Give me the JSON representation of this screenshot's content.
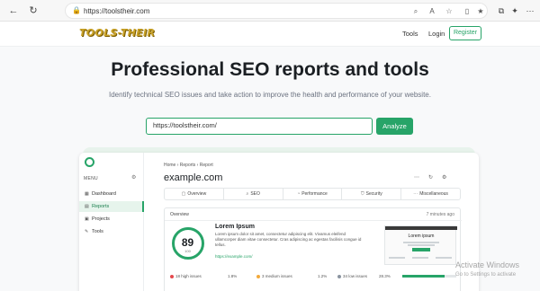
{
  "browser": {
    "url": "https://toolstheir.com",
    "back_icon": "arrow-left-icon",
    "refresh_icon": "refresh-icon"
  },
  "site": {
    "logo_text": "TOOLS-THEIR",
    "nav": {
      "tools": "Tools",
      "login": "Login",
      "register": "Register"
    },
    "accent_color": "#27a468"
  },
  "hero": {
    "title": "Professional SEO reports and tools",
    "subtitle": "Identify technical SEO issues and take action to improve the health and performance of your website.",
    "search_value": "https://toolstheir.com/",
    "analyze_label": "Analyze"
  },
  "preview": {
    "menu_label": "MENU",
    "sidebar": [
      {
        "label": "Dashboard",
        "icon": "dashboard-icon"
      },
      {
        "label": "Reports",
        "icon": "reports-icon",
        "active": true
      },
      {
        "label": "Projects",
        "icon": "projects-icon"
      },
      {
        "label": "Tools",
        "icon": "tools-icon"
      }
    ],
    "breadcrumbs": "Home  ›  Reports  ›  Report",
    "page_title": "example.com",
    "tabs": [
      "Overview",
      "SEO",
      "Performance",
      "Security",
      "Miscellaneous"
    ],
    "overview_title": "Overview",
    "overview_time": "7 minutes ago",
    "score": "89",
    "score_max": "100",
    "lorem_title": "Lorem Ipsum",
    "lorem_text": "Lorem ipsum dolor sit amet, consectetur adipiscing elit. Vivamus eleifend ullamcorper diam vitae consectetur. Cras adipiscing ac egestas facilisis congue id tellus.",
    "lorem_link": "https://example.com/",
    "thumb_title": "Lorem ipsum",
    "stats": [
      "18 high issues",
      "3 medium issues",
      "34 low issues"
    ],
    "stat_pcts": [
      "1.8%",
      "1.2%",
      "28.3%"
    ],
    "progress_fraction": 0.78
  },
  "watermark": {
    "title": "Activate Windows",
    "sub": "Go to Settings to activate"
  }
}
